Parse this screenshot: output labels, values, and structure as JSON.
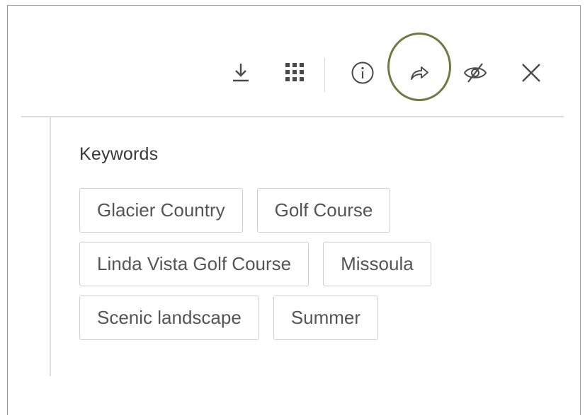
{
  "toolbar": {
    "buttons": [
      {
        "name": "download",
        "icon": "download-icon"
      },
      {
        "name": "grid",
        "icon": "grid-icon"
      },
      {
        "name": "info",
        "icon": "info-icon"
      },
      {
        "name": "share",
        "icon": "share-icon",
        "highlighted": true
      },
      {
        "name": "hide",
        "icon": "eye-off-icon"
      },
      {
        "name": "close",
        "icon": "close-icon"
      }
    ],
    "icon_color": "#4a4a4a",
    "highlight_color": "#6b7c46"
  },
  "keywords": {
    "title": "Keywords",
    "rows": [
      [
        "Glacier Country",
        "Golf Course"
      ],
      [
        "Linda Vista Golf Course",
        "Missoula"
      ],
      [
        "Scenic landscape",
        "Summer"
      ]
    ]
  }
}
